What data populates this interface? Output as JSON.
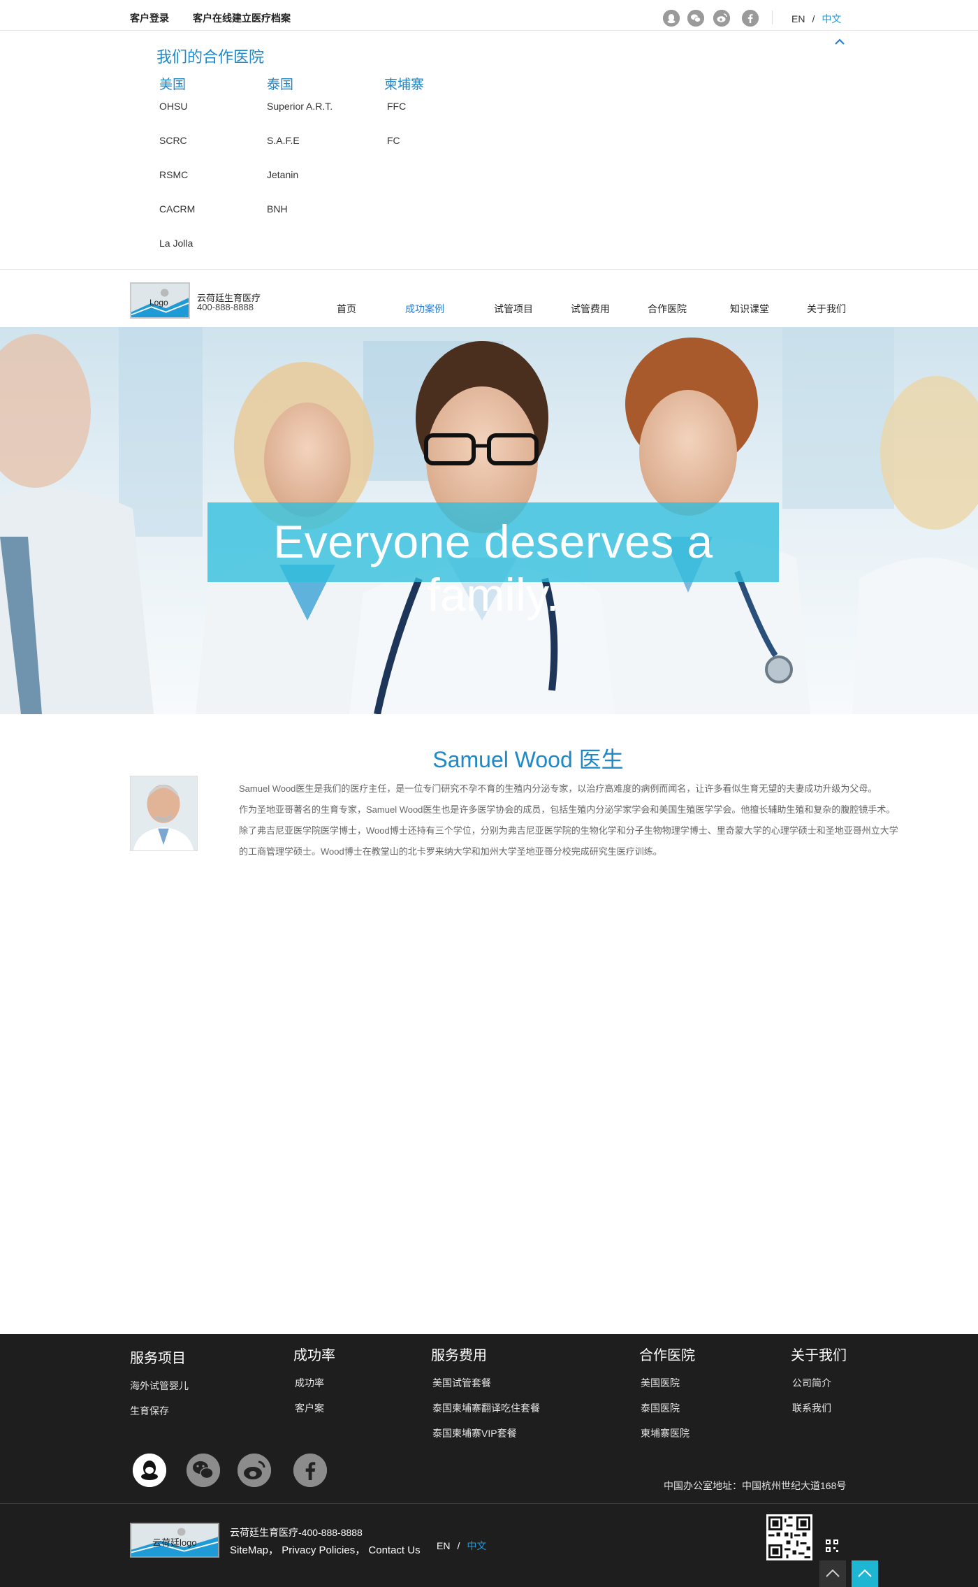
{
  "topbar": {
    "login": "客户登录",
    "records": "客户在线建立医疗档案",
    "social_icons": [
      "qq-icon",
      "wechat-icon",
      "weibo-icon",
      "facebook-icon"
    ],
    "lang_en": "EN",
    "lang_sep": "/",
    "lang_zh": "中文"
  },
  "hospitals": {
    "title": "我们的合作医院",
    "countries": [
      {
        "name": "美国",
        "items": [
          "OHSU",
          "SCRC",
          "RSMC",
          "CACRM",
          "La Jolla"
        ]
      },
      {
        "name": "泰国",
        "items": [
          "Superior A.R.T.",
          "S.A.F.E",
          "Jetanin",
          "BNH"
        ]
      },
      {
        "name": "柬埔寨",
        "items": [
          "FFC",
          "FC"
        ]
      }
    ]
  },
  "nav": {
    "logo_text": "Logo",
    "brand_name": "云荷廷生育医疗",
    "brand_phone": "400-888-8888",
    "items": [
      "首页",
      "成功案例",
      "试管项目",
      "试管费用",
      "合作医院",
      "知识课堂",
      "关于我们"
    ],
    "active_index": 1
  },
  "hero": {
    "tagline": "Everyone deserves a family."
  },
  "doctor": {
    "title": "Samuel Wood 医生",
    "bio_lines": [
      "Samuel Wood医生是我们的医疗主任，是一位专门研究不孕不育的生殖内分泌专家，以治疗高难度的病例而闻名，让许多看似生育无望的夫妻成功升级为父母。",
      "作为圣地亚哥著名的生育专家，Samuel Wood医生也是许多医学协会的成员，包括生殖内分泌学家学会和美国生殖医学学会。他擅长辅助生殖和复杂的腹腔镜手术。",
      "除了弗吉尼亚医学院医学博士，Wood博士还持有三个学位，分别为弗吉尼亚医学院的生物化学和分子生物物理学博士、里奇蒙大学的心理学硕士和圣地亚哥州立大学",
      "的工商管理学硕士。Wood博士在教堂山的北卡罗来纳大学和加州大学圣地亚哥分校完成研究生医疗训练。"
    ]
  },
  "footer": {
    "columns": [
      {
        "head": "服务项目",
        "links": [
          "海外试管婴儿",
          "生育保存"
        ]
      },
      {
        "head": "成功率",
        "links": [
          "成功率",
          "客户案"
        ]
      },
      {
        "head": "服务费用",
        "links": [
          "美国试管套餐",
          "泰国柬埔寨翻译吃住套餐",
          "泰国柬埔寨VIP套餐"
        ]
      },
      {
        "head": "合作医院",
        "links": [
          "美国医院",
          "泰国医院",
          "柬埔寨医院"
        ]
      },
      {
        "head": "关于我们",
        "links": [
          "公司简介",
          "联系我们"
        ]
      }
    ],
    "social_icons": [
      "qq-icon",
      "wechat-icon",
      "weibo-icon",
      "facebook-icon"
    ],
    "address": "中国办公室地址：中国杭州世纪大道168号",
    "logo_text": "云荷廷logo",
    "brand_line": "云荷廷生育医疗-400-888-8888",
    "sitemap": "SiteMap，",
    "privacy": "Privacy Policies，",
    "contact": "Contact Us",
    "lang_en": "EN",
    "lang_sep": "/",
    "lang_zh": "中文"
  },
  "colors": {
    "accent": "#1e88c8",
    "active_nav": "#2a7fd4",
    "tagline_bg": "#2ebedc",
    "footer_bg": "#1e1e1e",
    "to_top_active": "#1fb6d3"
  }
}
